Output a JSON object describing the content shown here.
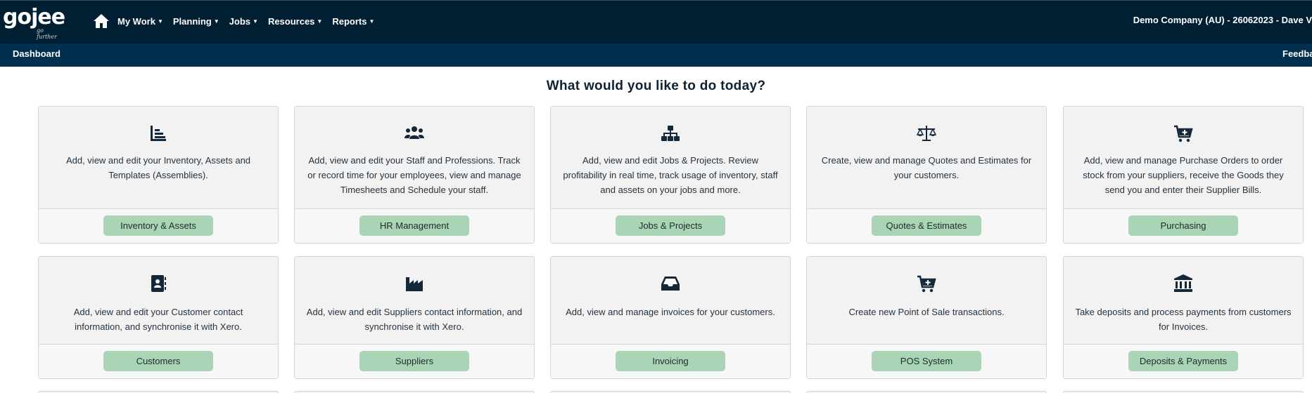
{
  "app": {
    "logo_main": "gojee",
    "logo_tagline": "go further",
    "company_user": "Demo Company (AU) - 26062023 - Dave V"
  },
  "nav": {
    "items": [
      {
        "label": "My Work"
      },
      {
        "label": "Planning"
      },
      {
        "label": "Jobs"
      },
      {
        "label": "Resources"
      },
      {
        "label": "Reports"
      }
    ]
  },
  "subnav": {
    "dashboard": "Dashboard",
    "feedback": "Feedba"
  },
  "page": {
    "heading": "What would you like to do today?"
  },
  "cards": [
    {
      "icon": "inventory-list-icon",
      "text": "Add, view and edit your Inventory, Assets and Templates (Assemblies).",
      "button": "Inventory & Assets"
    },
    {
      "icon": "users-group-icon",
      "text": "Add, view and edit your Staff and Professions. Track or record time for your employees, view and manage Timesheets and Schedule your staff.",
      "button": "HR Management"
    },
    {
      "icon": "sitemap-icon",
      "text": "Add, view and edit Jobs & Projects. Review profitability in real time, track usage of inventory, staff and assets on your jobs and more.",
      "button": "Jobs & Projects"
    },
    {
      "icon": "balance-scale-icon",
      "text": "Create, view and manage Quotes and Estimates for your customers.",
      "button": "Quotes & Estimates"
    },
    {
      "icon": "cart-plus-icon",
      "text": "Add, view and manage Purchase Orders to order stock from your suppliers, receive the Goods they send you and enter their Supplier Bills.",
      "button": "Purchasing"
    },
    {
      "icon": "address-book-icon",
      "text": "Add, view and edit your Customer contact information, and synchronise it with Xero.",
      "button": "Customers"
    },
    {
      "icon": "industry-icon",
      "text": "Add, view and edit Suppliers contact information, and synchronise it with Xero.",
      "button": "Suppliers"
    },
    {
      "icon": "inbox-icon",
      "text": "Add, view and manage invoices for your customers.",
      "button": "Invoicing"
    },
    {
      "icon": "cart-plus-icon",
      "text": "Create new Point of Sale transactions.",
      "button": "POS System"
    },
    {
      "icon": "bank-icon",
      "text": "Take deposits and process payments from customers for Invoices.",
      "button": "Deposits & Payments"
    }
  ],
  "colors": {
    "topbar": "#001f33",
    "subbar": "#00304d",
    "button": "#a9d4b6",
    "card": "#f2f2f2"
  }
}
